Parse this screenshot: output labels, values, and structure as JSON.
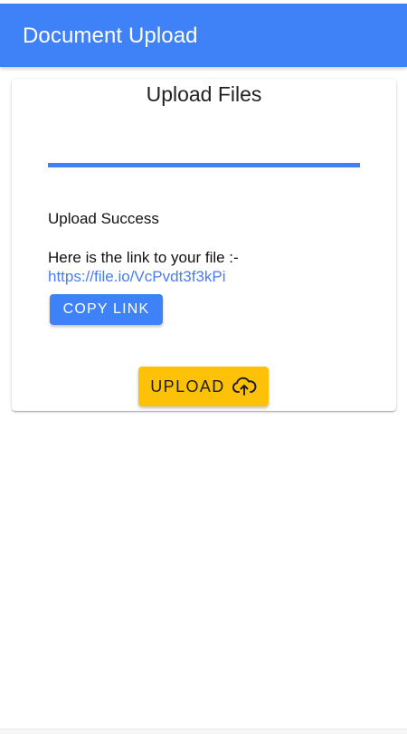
{
  "app_bar": {
    "title": "Document Upload",
    "color": "#3f82f7"
  },
  "card": {
    "title": "Upload Files",
    "progress": {
      "percent": 100,
      "color": "#3f82f7"
    },
    "status": "Upload Success",
    "link_intro": "Here is the link to your file :-",
    "file_link": "https://file.io/VcPvdt3f3kPi",
    "copy_button_label": "Copy Link",
    "upload_button_label": "Upload",
    "upload_icon": "cloud-upload-icon",
    "upload_button_color": "#fdc107"
  }
}
